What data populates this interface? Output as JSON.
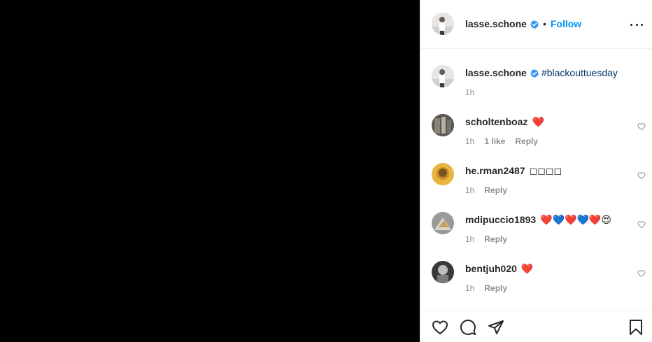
{
  "post": {
    "username": "lasse.schone",
    "separator": "•",
    "follow_label": "Follow"
  },
  "caption": {
    "username": "lasse.schone",
    "text": "#blackouttuesday",
    "time": "1h"
  },
  "comments": [
    {
      "username": "scholtenboaz",
      "text": "❤️",
      "time": "1h",
      "likes": "1 like",
      "reply": "Reply"
    },
    {
      "username": "he.rman2487",
      "text": "◻◻◻◻",
      "time": "1h",
      "reply": "Reply"
    },
    {
      "username": "mdipuccio1893",
      "text": "❤️💙❤️💙❤️😍",
      "time": "1h",
      "reply": "Reply"
    },
    {
      "username": "bentjuh020",
      "text": "❤️",
      "time": "1h",
      "reply": "Reply"
    }
  ],
  "colors": {
    "accent": "#0095f6",
    "hashtag": "#00376b",
    "muted": "#8e8e8e"
  },
  "icons": [
    "verified-icon",
    "more-icon",
    "like-icon",
    "comment-icon",
    "share-icon",
    "save-icon",
    "small-heart-icon"
  ]
}
